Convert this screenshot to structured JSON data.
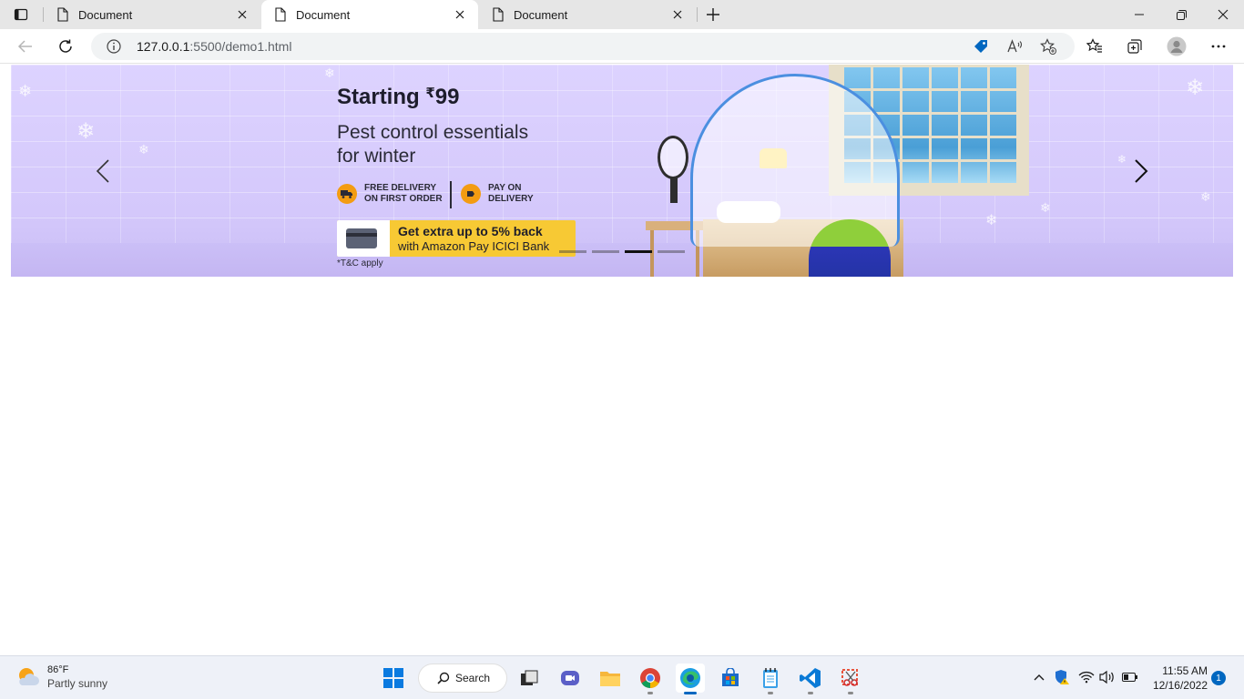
{
  "browser": {
    "tabs": [
      {
        "title": "Document",
        "active": false
      },
      {
        "title": "Document",
        "active": true
      },
      {
        "title": "Document",
        "active": false
      }
    ],
    "new_tab_glyph": "+",
    "address": {
      "host": "127.0.0.1",
      "path": ":5500/demo1.html"
    }
  },
  "banner": {
    "headline_prefix": "Starting ",
    "headline_currency": "₹",
    "headline_price": "99",
    "subtitle_line1": "Pest control essentials",
    "subtitle_line2": "for winter",
    "badge1": "FREE DELIVERY ON FIRST ORDER",
    "badge2": "PAY ON DELIVERY",
    "promo_line1": "Get extra up to 5% back",
    "promo_line2": "with Amazon Pay ICICI Bank",
    "terms": "*T&C apply",
    "active_slide": 3,
    "slide_count": 4
  },
  "taskbar": {
    "weather_temp": "86°F",
    "weather_condition": "Partly sunny",
    "search_label": "Search",
    "time": "11:55 AM",
    "date": "12/16/2022",
    "notification_count": "1"
  },
  "colors": {
    "banner_bg": "#d8cdfc",
    "promo_yellow": "#f7c934",
    "edge_blue": "#0067c0"
  }
}
